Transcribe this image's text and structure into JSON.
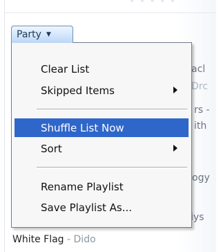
{
  "header_fade_text": "• • • • •",
  "playlist_menu_button": {
    "label": "Party",
    "caret_icon": "▼"
  },
  "menu": {
    "items": [
      {
        "label": "Clear List",
        "has_submenu": false
      },
      {
        "label": "Skipped Items",
        "has_submenu": true
      },
      {
        "label": "Shuffle List Now",
        "has_submenu": false,
        "highlighted": true
      },
      {
        "label": "Sort",
        "has_submenu": true
      },
      {
        "label": "Rename Playlist",
        "has_submenu": false
      },
      {
        "label": "Save Playlist As...",
        "has_submenu": false
      }
    ]
  },
  "background_fragments": [
    {
      "text": "acl",
      "dim": false
    },
    {
      "text": "Drc",
      "dim": true
    },
    {
      "text": "rs -",
      "dim": false
    },
    {
      "text": "ith",
      "dim": false
    },
    {
      "text": "ogy",
      "dim": false
    },
    {
      "text": "iys",
      "dim": false
    }
  ],
  "bottom_track": {
    "title": "White Flag",
    "separator": " - ",
    "artist": "Dido"
  },
  "colors": {
    "highlight": "#2f66c9",
    "button_top": "#eef6ff",
    "button_bottom": "#bcd6f4",
    "menu_background": "#f7f7f8"
  }
}
